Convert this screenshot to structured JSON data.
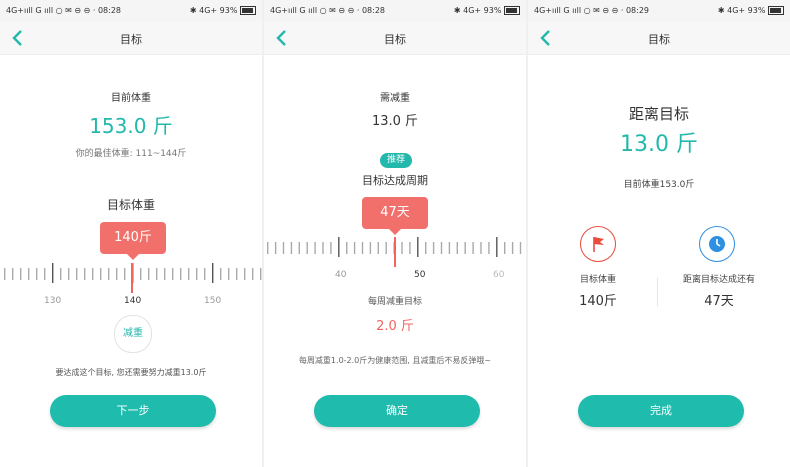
{
  "status": [
    {
      "left": "4G+ııll G ııll ○ ✉ ⊖ ⊖ · 08:28",
      "right": "✱ 4G+ 93%"
    },
    {
      "left": "4G+ııll G ııll ○ ✉ ⊖ ⊖ · 08:28",
      "right": "✱ 4G+ 93%"
    },
    {
      "left": "4G+ııll G ııll ○ ✉ ⊖ ⊖ · 08:29",
      "right": "✱ 4G+ 93%"
    }
  ],
  "nav_title": "目标",
  "screen1": {
    "current_label": "目前体重",
    "current_value": "153.0 斤",
    "ideal_text": "你的最佳体重: 111~144斤",
    "target_label": "目标体重",
    "bubble": "140斤",
    "ticks": [
      "130",
      "140",
      "150"
    ],
    "badge": "减重",
    "hint": "要达成这个目标, 您还需要努力减重13.0斤",
    "button": "下一步"
  },
  "screen2": {
    "need_label": "需减重",
    "need_value": "13.0 斤",
    "recommend_tag": "推荐",
    "period_label": "目标达成周期",
    "bubble": "47天",
    "ticks": [
      "40",
      "50",
      "60"
    ],
    "weekly_label": "每周减重目标",
    "weekly_value": "2.0 斤",
    "hint": "每周减重1.0-2.0斤为健康范围, 且减重后不易反弹哦~",
    "button": "确定"
  },
  "screen3": {
    "distance_label": "距离目标",
    "distance_value": "13.0 斤",
    "current_text": "目前体重153.0斤",
    "target_label": "目标体重",
    "target_value": "140斤",
    "remain_label": "距离目标达成还有",
    "remain_value": "47天",
    "button": "完成"
  },
  "colors": {
    "accent": "#1fbcae",
    "red": "#f2645f",
    "flag": "#e74c3c",
    "clock": "#2f8fe0"
  }
}
